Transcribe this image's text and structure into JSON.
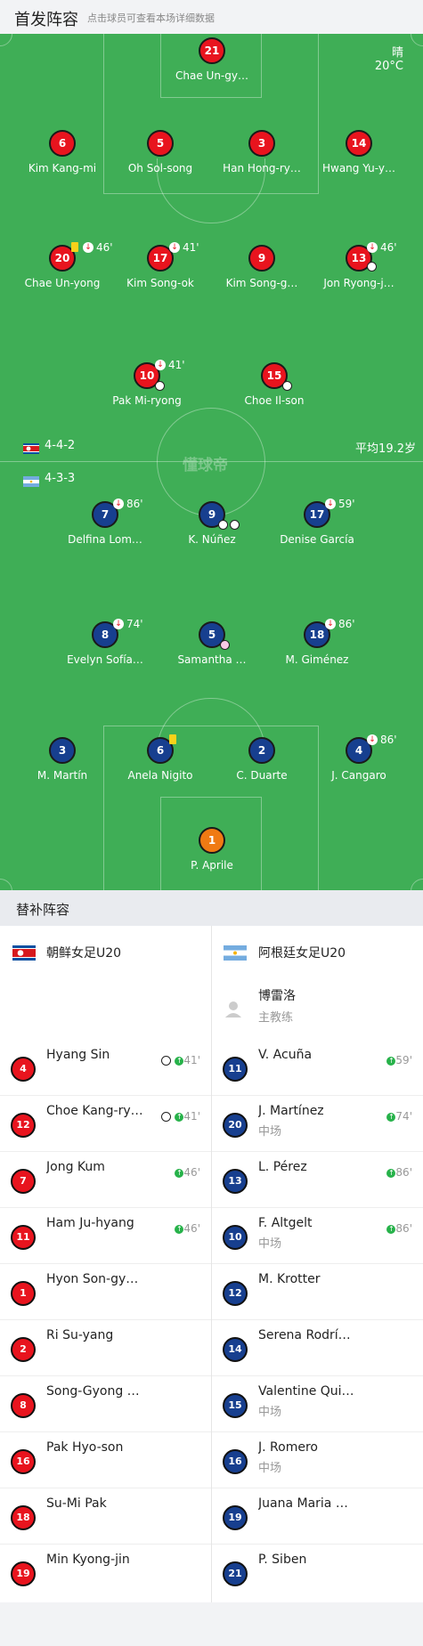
{
  "header": {
    "title": "首发阵容",
    "subtitle": "点击球员可查看本场详细数据"
  },
  "weather": {
    "condition": "晴",
    "temp": "20°C"
  },
  "watermark": "懂球帝",
  "home_team": {
    "formation": "4-4-2",
    "avg_age": "平均19.2岁",
    "players": [
      {
        "num": "21",
        "name": "Chae Un-gy…"
      },
      {
        "num": "6",
        "name": "Kim Kang-mi"
      },
      {
        "num": "5",
        "name": "Oh Sol-song"
      },
      {
        "num": "3",
        "name": "Han Hong-ry…"
      },
      {
        "num": "14",
        "name": "Hwang Yu-y…"
      },
      {
        "num": "20",
        "name": "Chae Un-yong",
        "ev": "46'"
      },
      {
        "num": "17",
        "name": "Kim Song-ok",
        "ev": "41'"
      },
      {
        "num": "9",
        "name": "Kim Song-g…"
      },
      {
        "num": "13",
        "name": "Jon Ryong-j…",
        "ev": "46'"
      },
      {
        "num": "10",
        "name": "Pak Mi-ryong",
        "ev": "41'"
      },
      {
        "num": "15",
        "name": "Choe Il-son"
      }
    ]
  },
  "away_team": {
    "formation": "4-3-3",
    "players": [
      {
        "num": "7",
        "name": "Delfina Lom…",
        "ev": "86'"
      },
      {
        "num": "9",
        "name": "K. Núñez"
      },
      {
        "num": "17",
        "name": "Denise García",
        "ev": "59'"
      },
      {
        "num": "8",
        "name": "Evelyn Sofía…",
        "ev": "74'"
      },
      {
        "num": "5",
        "name": "Samantha …"
      },
      {
        "num": "18",
        "name": "M. Giménez",
        "ev": "86'"
      },
      {
        "num": "3",
        "name": "M. Martín"
      },
      {
        "num": "6",
        "name": "Anela Nigito"
      },
      {
        "num": "2",
        "name": "C. Duarte"
      },
      {
        "num": "4",
        "name": "J. Cangaro",
        "ev": "86'"
      },
      {
        "num": "1",
        "name": "P. Aprile"
      }
    ]
  },
  "subs": {
    "title": "替补阵容",
    "home_name": "朝鲜女足U20",
    "away_name": "阿根廷女足U20",
    "coach": {
      "name": "博雷洛",
      "role": "主教练"
    },
    "home": [
      {
        "num": "4",
        "name": "Hyang Sin",
        "ev": "41'"
      },
      {
        "num": "12",
        "name": "Choe Kang-ry…",
        "ev": "41'"
      },
      {
        "num": "7",
        "name": "Jong Kum",
        "ev": "46'"
      },
      {
        "num": "11",
        "name": "Ham Ju-hyang",
        "ev": "46'"
      },
      {
        "num": "1",
        "name": "Hyon Son-gy…"
      },
      {
        "num": "2",
        "name": "Ri Su-yang"
      },
      {
        "num": "8",
        "name": "Song-Gyong …"
      },
      {
        "num": "16",
        "name": "Pak Hyo-son"
      },
      {
        "num": "18",
        "name": "Su-Mi Pak"
      },
      {
        "num": "19",
        "name": "Min Kyong-jin"
      }
    ],
    "away": [
      {
        "num": "11",
        "name": "V. Acuña",
        "ev": "59'"
      },
      {
        "num": "20",
        "name": "J. Martínez",
        "pos": "中场",
        "ev": "74'"
      },
      {
        "num": "13",
        "name": "L. Pérez",
        "ev": "86'"
      },
      {
        "num": "10",
        "name": "F. Altgelt",
        "pos": "中场",
        "ev": "86'"
      },
      {
        "num": "12",
        "name": "M. Krotter"
      },
      {
        "num": "14",
        "name": "Serena Rodrí…"
      },
      {
        "num": "15",
        "name": "Valentine Qui…",
        "pos": "中场"
      },
      {
        "num": "16",
        "name": "J. Romero",
        "pos": "中场"
      },
      {
        "num": "19",
        "name": "Juana Maria …"
      },
      {
        "num": "21",
        "name": "P. Siben"
      }
    ]
  },
  "colors": {
    "pitch": "#3fae56",
    "home": "#e8141e",
    "away": "#173f8f",
    "gk_away": "#f07a13"
  }
}
